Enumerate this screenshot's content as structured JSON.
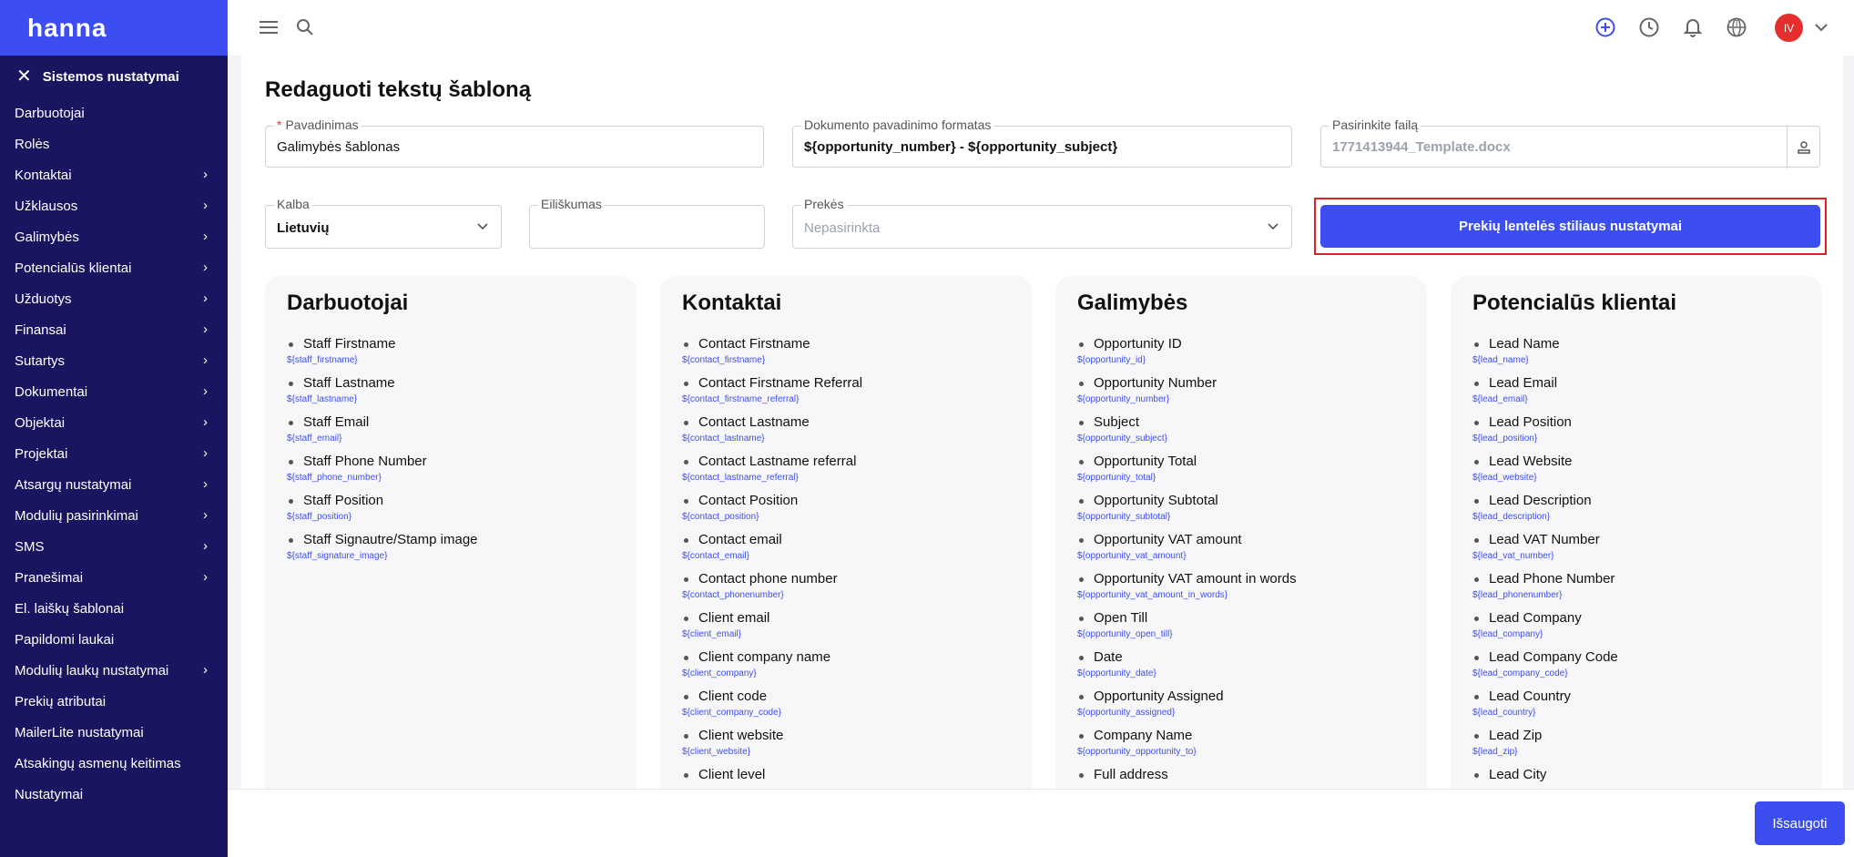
{
  "brand": "hanna",
  "sidebar": {
    "header": "Sistemos nustatymai",
    "items": [
      {
        "label": "Darbuotojai",
        "chevron": false
      },
      {
        "label": "Rolės",
        "chevron": false
      },
      {
        "label": "Kontaktai",
        "chevron": true
      },
      {
        "label": "Užklausos",
        "chevron": true
      },
      {
        "label": "Galimybės",
        "chevron": true
      },
      {
        "label": "Potencialūs klientai",
        "chevron": true
      },
      {
        "label": "Užduotys",
        "chevron": true
      },
      {
        "label": "Finansai",
        "chevron": true
      },
      {
        "label": "Sutartys",
        "chevron": true
      },
      {
        "label": "Dokumentai",
        "chevron": true
      },
      {
        "label": "Objektai",
        "chevron": true
      },
      {
        "label": "Projektai",
        "chevron": true
      },
      {
        "label": "Atsargų nustatymai",
        "chevron": true
      },
      {
        "label": "Modulių pasirinkimai",
        "chevron": true
      },
      {
        "label": "SMS",
        "chevron": true
      },
      {
        "label": "Pranešimai",
        "chevron": true
      },
      {
        "label": "El. laiškų šablonai",
        "chevron": false
      },
      {
        "label": "Papildomi laukai",
        "chevron": false
      },
      {
        "label": "Modulių laukų nustatymai",
        "chevron": true
      },
      {
        "label": "Prekių atributai",
        "chevron": false
      },
      {
        "label": "MailerLite nustatymai",
        "chevron": false
      },
      {
        "label": "Atsakingų asmenų keitimas",
        "chevron": false
      },
      {
        "label": "Nustatymai",
        "chevron": false
      }
    ]
  },
  "topbar": {
    "lang": "LT",
    "avatar": "IV"
  },
  "page": {
    "title": "Redaguoti tekstų šabloną"
  },
  "form": {
    "name_label": "Pavadinimas",
    "name_value": "Galimybės šablonas",
    "docname_label": "Dokumento pavadinimo formatas",
    "docname_value": "${opportunity_number} - ${opportunity_subject}",
    "file_label": "Pasirinkite failą",
    "file_value": "1771413944_Template.docx",
    "lang_label": "Kalba",
    "lang_value": "Lietuvių",
    "order_label": "Eiliškumas",
    "order_value": "",
    "products_label": "Prekės",
    "products_value": "Nepasirinkta",
    "style_button": "Prekių lentelės stiliaus nustatymai"
  },
  "cards": [
    {
      "title": "Darbuotojai",
      "items": [
        {
          "name": "Staff Firstname",
          "var": "${staff_firstname}"
        },
        {
          "name": "Staff Lastname",
          "var": "${staff_lastname}"
        },
        {
          "name": "Staff Email",
          "var": "${staff_email}"
        },
        {
          "name": "Staff Phone Number",
          "var": "${staff_phone_number}"
        },
        {
          "name": "Staff Position",
          "var": "${staff_position}"
        },
        {
          "name": "Staff Signautre/Stamp image",
          "var": "${staff_signature_image}"
        }
      ]
    },
    {
      "title": "Kontaktai",
      "items": [
        {
          "name": "Contact Firstname",
          "var": "${contact_firstname}"
        },
        {
          "name": "Contact Firstname Referral",
          "var": "${contact_firstname_referral}"
        },
        {
          "name": "Contact Lastname",
          "var": "${contact_lastname}"
        },
        {
          "name": "Contact Lastname referral",
          "var": "${contact_lastname_referral}"
        },
        {
          "name": "Contact Position",
          "var": "${contact_position}"
        },
        {
          "name": "Contact email",
          "var": "${contact_email}"
        },
        {
          "name": "Contact phone number",
          "var": "${contact_phonenumber}"
        },
        {
          "name": "Client email",
          "var": "${client_email}"
        },
        {
          "name": "Client company name",
          "var": "${client_company}"
        },
        {
          "name": "Client code",
          "var": "${client_company_code}"
        },
        {
          "name": "Client website",
          "var": "${client_website}"
        },
        {
          "name": "Client level",
          "var": ""
        }
      ]
    },
    {
      "title": "Galimybės",
      "items": [
        {
          "name": "Opportunity ID",
          "var": "${opportunity_id}"
        },
        {
          "name": "Opportunity Number",
          "var": "${opportunity_number}"
        },
        {
          "name": "Subject",
          "var": "${opportunity_subject}"
        },
        {
          "name": "Opportunity Total",
          "var": "${opportunity_total}"
        },
        {
          "name": "Opportunity Subtotal",
          "var": "${opportunity_subtotal}"
        },
        {
          "name": "Opportunity VAT amount",
          "var": "${opportunity_vat_amount}"
        },
        {
          "name": "Opportunity VAT amount in words",
          "var": "${opportunity_vat_amount_in_words}"
        },
        {
          "name": "Open Till",
          "var": "${opportunity_open_till}"
        },
        {
          "name": "Date",
          "var": "${opportunity_date}"
        },
        {
          "name": "Opportunity Assigned",
          "var": "${opportunity_assigned}"
        },
        {
          "name": "Company Name",
          "var": "${opportunity_opportunity_to}"
        },
        {
          "name": "Full address",
          "var": ""
        }
      ]
    },
    {
      "title": "Potencialūs klientai",
      "items": [
        {
          "name": "Lead Name",
          "var": "${lead_name}"
        },
        {
          "name": "Lead Email",
          "var": "${lead_email}"
        },
        {
          "name": "Lead Position",
          "var": "${lead_position}"
        },
        {
          "name": "Lead Website",
          "var": "${lead_website}"
        },
        {
          "name": "Lead Description",
          "var": "${lead_description}"
        },
        {
          "name": "Lead VAT Number",
          "var": "${lead_vat_number}"
        },
        {
          "name": "Lead Phone Number",
          "var": "${lead_phonenumber}"
        },
        {
          "name": "Lead Company",
          "var": "${lead_company}"
        },
        {
          "name": "Lead Company Code",
          "var": "${lead_company_code}"
        },
        {
          "name": "Lead Country",
          "var": "${lead_country}"
        },
        {
          "name": "Lead Zip",
          "var": "${lead_zip}"
        },
        {
          "name": "Lead City",
          "var": ""
        }
      ]
    }
  ],
  "footer": {
    "save": "Išsaugoti"
  },
  "colors": {
    "primary": "#3d4ef0",
    "sidebar": "#1a1560",
    "highlight": "#e02020",
    "avatar": "#e62e2e"
  }
}
